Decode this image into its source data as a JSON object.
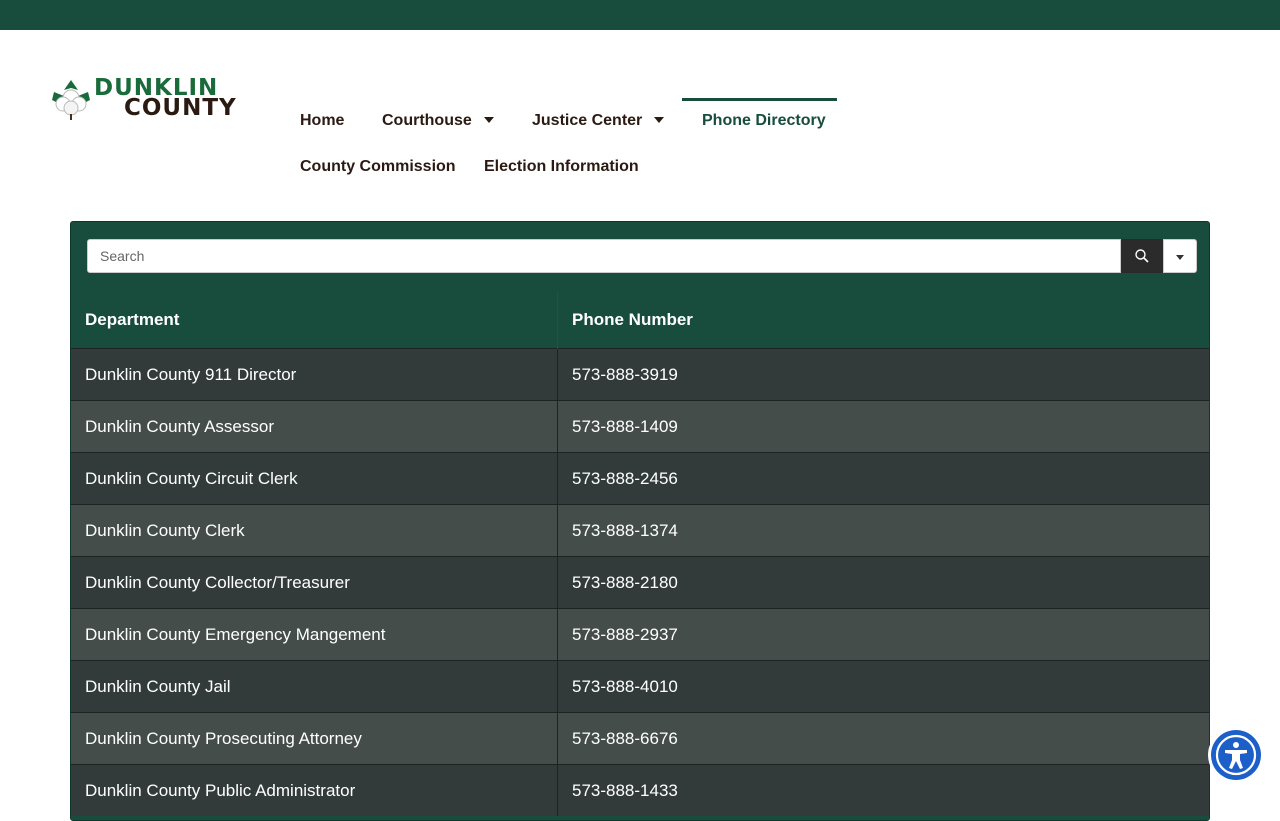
{
  "logo": {
    "line1": "DUNKLIN",
    "line2": "COUNTY",
    "icon": "cotton-boll-icon",
    "colors": {
      "green": "#1a6b3a",
      "brown": "#2a1a12"
    }
  },
  "nav": {
    "items": [
      {
        "label": "Home",
        "has_dropdown": false,
        "active": false
      },
      {
        "label": "Courthouse",
        "has_dropdown": true,
        "active": false
      },
      {
        "label": "Justice Center",
        "has_dropdown": true,
        "active": false
      },
      {
        "label": "Phone Directory",
        "has_dropdown": false,
        "active": true
      },
      {
        "label": "County Commission",
        "has_dropdown": false,
        "active": false
      },
      {
        "label": "Election Information",
        "has_dropdown": false,
        "active": false
      }
    ]
  },
  "directory": {
    "search": {
      "placeholder": "Search",
      "value": "",
      "search_icon": "search-icon",
      "dropdown_icon": "caret-down-icon"
    },
    "columns": [
      "Department",
      "Phone Number"
    ],
    "rows": [
      {
        "department": "Dunklin County 911 Director",
        "phone": "573-888-3919"
      },
      {
        "department": "Dunklin County Assessor",
        "phone": "573-888-1409"
      },
      {
        "department": "Dunklin County Circuit Clerk",
        "phone": "573-888-2456"
      },
      {
        "department": "Dunklin County Clerk",
        "phone": "573-888-1374"
      },
      {
        "department": "Dunklin County Collector/Treasurer",
        "phone": "573-888-2180"
      },
      {
        "department": "Dunklin County Emergency Mangement",
        "phone": "573-888-2937"
      },
      {
        "department": "Dunklin County Jail",
        "phone": "573-888-4010"
      },
      {
        "department": "Dunklin County Prosecuting Attorney",
        "phone": "573-888-6676"
      },
      {
        "department": "Dunklin County Public Administrator",
        "phone": "573-888-1433"
      }
    ]
  },
  "accessibility": {
    "icon": "accessibility-icon"
  },
  "colors": {
    "brand_green": "#184d3d",
    "row_dark": "#333a3a",
    "row_light": "#454d4b",
    "accessibility_blue": "#1c5fc9"
  }
}
